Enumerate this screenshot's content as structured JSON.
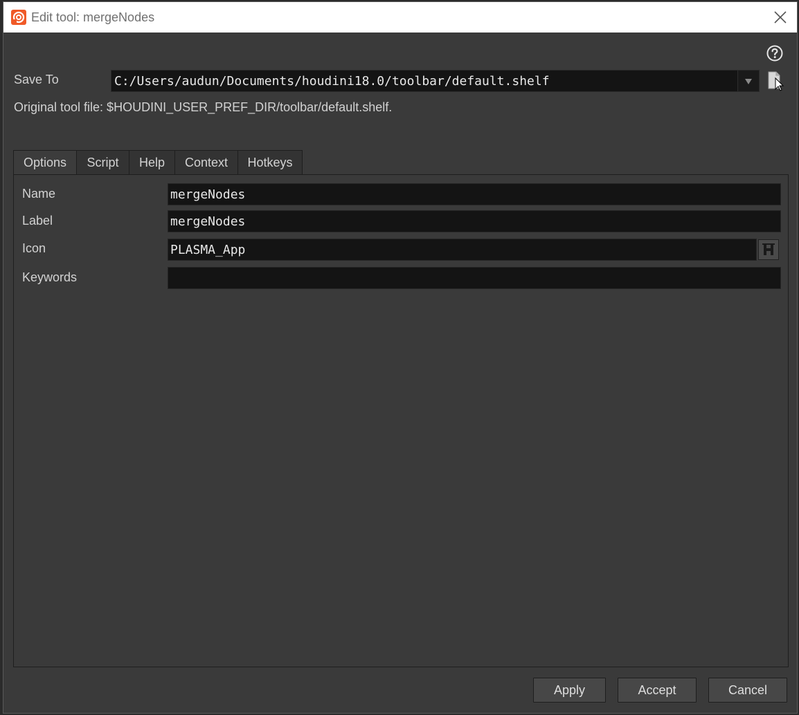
{
  "window": {
    "title": "Edit tool: mergeNodes"
  },
  "save_to": {
    "label": "Save To",
    "value": "C:/Users/audun/Documents/houdini18.0/toolbar/default.shelf"
  },
  "original_file": "Original tool file: $HOUDINI_USER_PREF_DIR/toolbar/default.shelf.",
  "tabs": [
    {
      "label": "Options",
      "active": true
    },
    {
      "label": "Script",
      "active": false
    },
    {
      "label": "Help",
      "active": false
    },
    {
      "label": "Context",
      "active": false
    },
    {
      "label": "Hotkeys",
      "active": false
    }
  ],
  "options": {
    "name": {
      "label": "Name",
      "value": "mergeNodes"
    },
    "tool_label": {
      "label": "Label",
      "value": "mergeNodes"
    },
    "icon": {
      "label": "Icon",
      "value": "PLASMA_App"
    },
    "keywords": {
      "label": "Keywords",
      "value": ""
    }
  },
  "buttons": {
    "apply": "Apply",
    "accept": "Accept",
    "cancel": "Cancel"
  },
  "icons": {
    "app": "houdini-logo-icon",
    "close": "close-icon",
    "help": "help-circle-icon",
    "file": "file-chooser-icon",
    "icon_chooser": "icon-chooser-icon",
    "dropdown": "dropdown-arrow-icon"
  },
  "colors": {
    "brand": "#f05a28",
    "panel_bg": "#3a3a3a",
    "field_bg": "#141414"
  }
}
